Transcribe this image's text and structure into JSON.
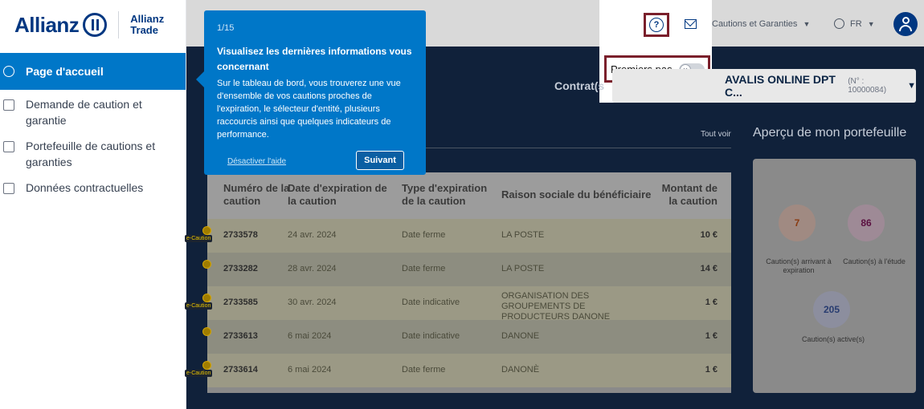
{
  "brand": {
    "name": "Allianz",
    "sub_line1": "Allianz",
    "sub_line2": "Trade"
  },
  "sidebar": {
    "items": [
      {
        "label": "Page d'accueil",
        "active": true
      },
      {
        "label": "Demande de caution et garantie"
      },
      {
        "label": "Portefeuille de cautions et garanties"
      },
      {
        "label": "Données contractuelles"
      }
    ]
  },
  "header": {
    "cautions_menu": "Cautions et Garanties",
    "language": "FR",
    "help_symbol": "?",
    "premiers_pas": "Premiers pas"
  },
  "contract": {
    "label": "Contrat(s",
    "selected": "AVALIS ONLINE DPT C...",
    "number": "(N° : 10000084)"
  },
  "tooltip": {
    "step": "1/15",
    "title": "Visualisez les dernières informations vous concernant",
    "body": "Sur le tableau de bord, vous trouverez une vue d'ensemble de vos cautions proches de l'expiration, le sélecteur d'entité, plusieurs raccourcis ainsi que quelques indicateurs de performance.",
    "disable": "Désactiver l'aide",
    "next": "Suivant"
  },
  "table": {
    "tout_voir": "Tout voir",
    "headers": [
      "Numéro de la caution",
      "Date d'expiration de la caution",
      "Type d'expiration de la caution",
      "Raison sociale du bénéficiaire",
      "Montant de la caution"
    ],
    "rows": [
      {
        "badge": "e-Caution",
        "number": "2733578",
        "date": "24 avr. 2024",
        "type": "Date ferme",
        "beneficiary": "LA POSTE",
        "amount": "10 €"
      },
      {
        "badge": "",
        "number": "2733282",
        "date": "28 avr. 2024",
        "type": "Date ferme",
        "beneficiary": "LA POSTE",
        "amount": "14 €"
      },
      {
        "badge": "e-Caution",
        "number": "2733585",
        "date": "30 avr. 2024",
        "type": "Date indicative",
        "beneficiary": "ORGANISATION DES GROUPEMENTS DE PRODUCTEURS DANONE",
        "amount": "1 €"
      },
      {
        "badge": "",
        "number": "2733613",
        "date": "6 mai 2024",
        "type": "Date indicative",
        "beneficiary": "DANONE",
        "amount": "1 €"
      },
      {
        "badge": "e-Caution",
        "number": "2733614",
        "date": "6 mai 2024",
        "type": "Date ferme",
        "beneficiary": "DANONÈ",
        "amount": "1 €"
      }
    ]
  },
  "portfolio": {
    "title": "Aperçu de mon portefeuille",
    "stats": [
      {
        "value": "7",
        "label": "Caution(s) arrivant à expiration"
      },
      {
        "value": "86",
        "label": "Caution(s) à l'étude"
      },
      {
        "value": "205",
        "label": "Caution(s) active(s)"
      }
    ]
  },
  "colors": {
    "brand": "#003781",
    "accent": "#0077c8",
    "highlight_border": "#7a1f2b"
  }
}
